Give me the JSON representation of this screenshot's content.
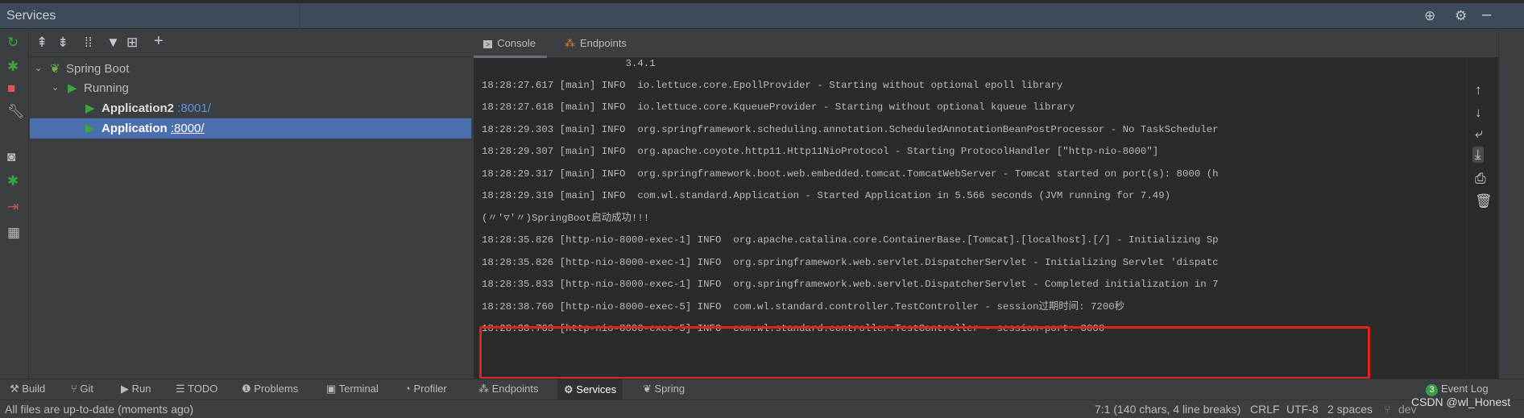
{
  "window": {
    "title": "Services"
  },
  "tree": {
    "items": [
      {
        "label": "Spring Boot"
      },
      {
        "label": "Running"
      },
      {
        "label": "Application2",
        "port": ":8001/"
      },
      {
        "label": "Application",
        "port": ":8000/"
      }
    ]
  },
  "tabs": [
    {
      "label": "Console"
    },
    {
      "label": "Endpoints"
    }
  ],
  "console": {
    "lines": [
      "                        3.4.1",
      "18:28:27.617 [main] INFO  io.lettuce.core.EpollProvider - Starting without optional epoll library",
      "18:28:27.618 [main] INFO  io.lettuce.core.KqueueProvider - Starting without optional kqueue library",
      "18:28:29.303 [main] INFO  org.springframework.scheduling.annotation.ScheduledAnnotationBeanPostProcessor - No TaskScheduler",
      "18:28:29.307 [main] INFO  org.apache.coyote.http11.Http11NioProtocol - Starting ProtocolHandler [\"http-nio-8000\"]",
      "18:28:29.317 [main] INFO  org.springframework.boot.web.embedded.tomcat.TomcatWebServer - Tomcat started on port(s): 8000 (h",
      "18:28:29.319 [main] INFO  com.wl.standard.Application - Started Application in 5.566 seconds (JVM running for 7.49)",
      "(〃'▽'〃)SpringBoot启动成功!!!",
      "18:28:35.826 [http-nio-8000-exec-1] INFO  org.apache.catalina.core.ContainerBase.[Tomcat].[localhost].[/] - Initializing Sp",
      "18:28:35.826 [http-nio-8000-exec-1] INFO  org.springframework.web.servlet.DispatcherServlet - Initializing Servlet 'dispatc",
      "18:28:35.833 [http-nio-8000-exec-1] INFO  org.springframework.web.servlet.DispatcherServlet - Completed initialization in 7",
      "18:28:38.760 [http-nio-8000-exec-5] INFO  com.wl.standard.controller.TestController - session过期时间: 7200秒",
      "18:28:38.763 [http-nio-8000-exec-5] INFO  com.wl.standard.controller.TestController - session-port: 8000"
    ]
  },
  "toolwindows": [
    {
      "label": "Build",
      "icon": "hammer-icon"
    },
    {
      "label": "Git",
      "icon": "git-icon"
    },
    {
      "label": "Run",
      "icon": "run-icon"
    },
    {
      "label": "TODO",
      "icon": "list-icon"
    },
    {
      "label": "Problems",
      "icon": "problems-icon"
    },
    {
      "label": "Terminal",
      "icon": "terminal-icon"
    },
    {
      "label": "Profiler",
      "icon": "profiler-icon"
    },
    {
      "label": "Endpoints",
      "icon": "endpoints-icon"
    },
    {
      "label": "Services",
      "icon": "services-icon"
    },
    {
      "label": "Spring",
      "icon": "spring-icon"
    }
  ],
  "event_log": {
    "count": "3",
    "label": "Event Log"
  },
  "status": {
    "message": "All files are up-to-date (moments ago)",
    "position": "7:1 (140 chars, 4 line breaks)",
    "line_sep": "CRLF",
    "encoding": "UTF-8",
    "indent": "2 spaces",
    "branch": "dev",
    "watermark": "CSDN @wl_Honest"
  },
  "colors": {
    "accent": "#4b6eaf",
    "highlight_box": "#e0241c",
    "run_green": "#3fa33f"
  }
}
